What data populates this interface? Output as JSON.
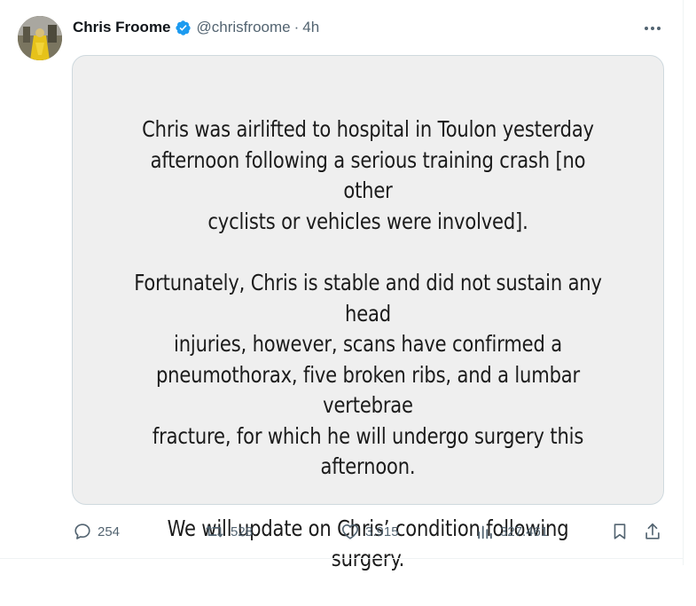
{
  "tweet": {
    "author_name": "Chris Froome",
    "handle": "@chrisfroome",
    "separator": "·",
    "time": "4h",
    "verified": true,
    "image_text": {
      "p1": "Chris  was airlifted to hospital in Toulon yesterday\nafternoon following a serious training crash [no other\ncyclists or vehicles were involved].",
      "p2": "Fortunately, Chris is stable and did not sustain any head\ninjuries, however, scans have confirmed a\npneumothorax, five broken ribs, and a lumbar vertebrae\nfracture, for which he will undergo surgery this\nafternoon.",
      "p3": "We will update on Chris’ condition following surgery."
    }
  },
  "actions": {
    "replies": "254",
    "reposts": "528",
    "likes": "3.915",
    "views": "327.461"
  },
  "icons": {
    "more": "more-dots-icon",
    "verified": "verified-badge-icon",
    "reply": "reply-icon",
    "repost": "repost-icon",
    "like": "like-icon",
    "views": "views-icon",
    "bookmark": "bookmark-icon",
    "share": "share-icon"
  },
  "colors": {
    "verified": "#1d9bf0",
    "muted": "#536471",
    "card_bg": "#efefef"
  }
}
